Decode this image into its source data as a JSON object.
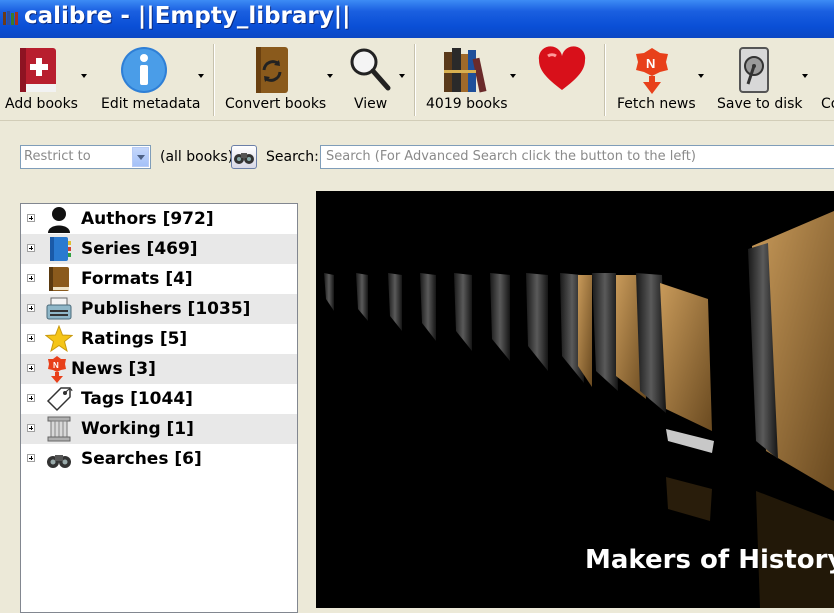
{
  "window": {
    "title": "calibre - ||Empty_library||"
  },
  "toolbar": {
    "add_books": "Add books",
    "edit_metadata": "Edit metadata",
    "convert_books": "Convert books",
    "view": "View",
    "library_books": "4019 books",
    "fetch_news": "Fetch news",
    "save_to_disk": "Save to disk",
    "connect_share": "Co"
  },
  "search": {
    "restrict_placeholder": "Restrict to",
    "all_books": "(all books)",
    "label": "Search:",
    "placeholder": "Search (For Advanced Search click the button to the left)"
  },
  "tag_browser": {
    "items": [
      {
        "label": "Authors [972]",
        "icon": "person-silhouette-icon"
      },
      {
        "label": "Series [469]",
        "icon": "notebook-icon"
      },
      {
        "label": "Formats [4]",
        "icon": "book-icon"
      },
      {
        "label": "Publishers [1035]",
        "icon": "typewriter-icon"
      },
      {
        "label": "Ratings [5]",
        "icon": "star-icon"
      },
      {
        "label": "News [3]",
        "icon": "news-icon"
      },
      {
        "label": "Tags [1044]",
        "icon": "tag-icon"
      },
      {
        "label": "Working [1]",
        "icon": "column-icon"
      },
      {
        "label": "Searches [6]",
        "icon": "binoculars-icon"
      }
    ]
  },
  "cover_flow": {
    "current_title": "Makers of History"
  },
  "colors": {
    "titlebar": "#0a4fd6",
    "window_bg": "#ece9d8",
    "coverflow_bg": "#000000"
  }
}
